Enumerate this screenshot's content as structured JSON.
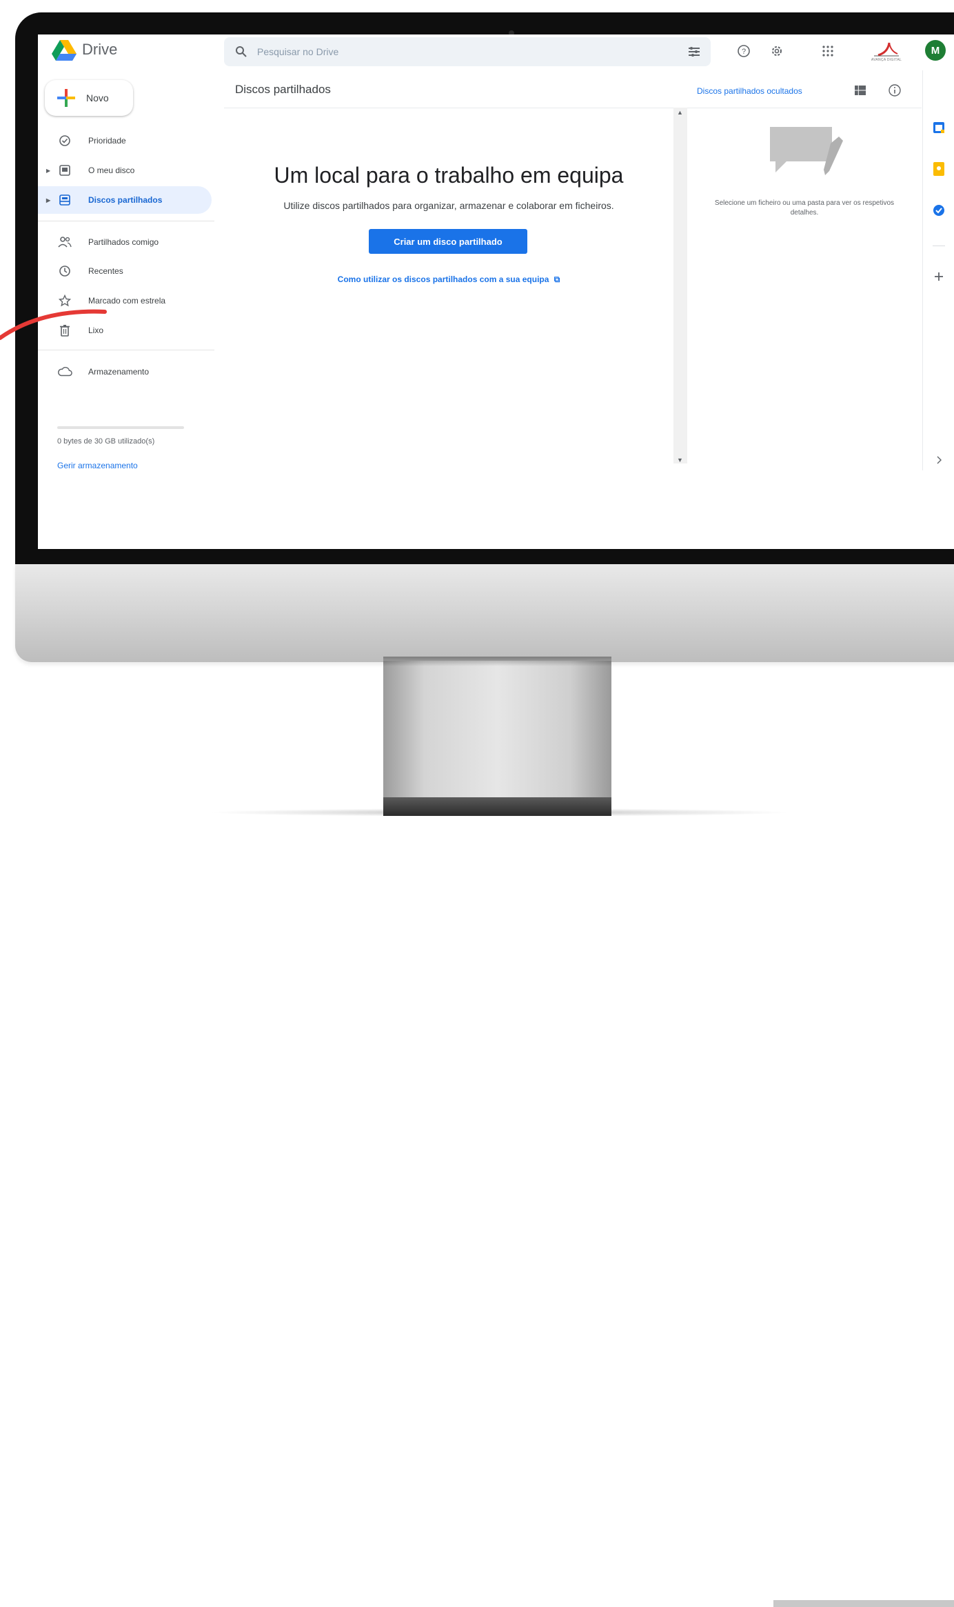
{
  "app": {
    "name": "Drive",
    "search_placeholder": "Pesquisar no Drive",
    "avatar_initial": "M",
    "brand_logo_text": "AVANÇA DIGITAL"
  },
  "sidebar": {
    "new_label": "Novo",
    "items": [
      {
        "label": "Prioridade",
        "icon": "check-circle-icon"
      },
      {
        "label": "O meu disco",
        "icon": "my-drive-icon"
      },
      {
        "label": "Discos partilhados",
        "icon": "shared-drives-icon",
        "active": true
      },
      {
        "label": "Partilhados comigo",
        "icon": "people-icon"
      },
      {
        "label": "Recentes",
        "icon": "clock-icon"
      },
      {
        "label": "Marcado com estrela",
        "icon": "star-icon"
      },
      {
        "label": "Lixo",
        "icon": "trash-icon"
      },
      {
        "label": "Armazenamento",
        "icon": "cloud-icon"
      }
    ],
    "storage_text": "0 bytes de 30 GB utilizado(s)",
    "storage_link": "Gerir armazenamento"
  },
  "main": {
    "title": "Discos partilhados",
    "hidden_link": "Discos partilhados ocultados",
    "hero_title": "Um local para o trabalho em equipa",
    "hero_subtitle": "Utilize discos partilhados para organizar, armazenar e colaborar em ficheiros.",
    "cta_label": "Criar um disco partilhado",
    "help_link": "Como utilizar os discos partilhados com a sua equipa"
  },
  "details": {
    "text": "Selecione um ficheiro ou uma pasta para ver os respetivos detalhes."
  },
  "colors": {
    "accent": "#1a73e8",
    "active_bg": "#e8f0fe",
    "avatar": "#1e7e34",
    "annotation": "#e53935"
  }
}
